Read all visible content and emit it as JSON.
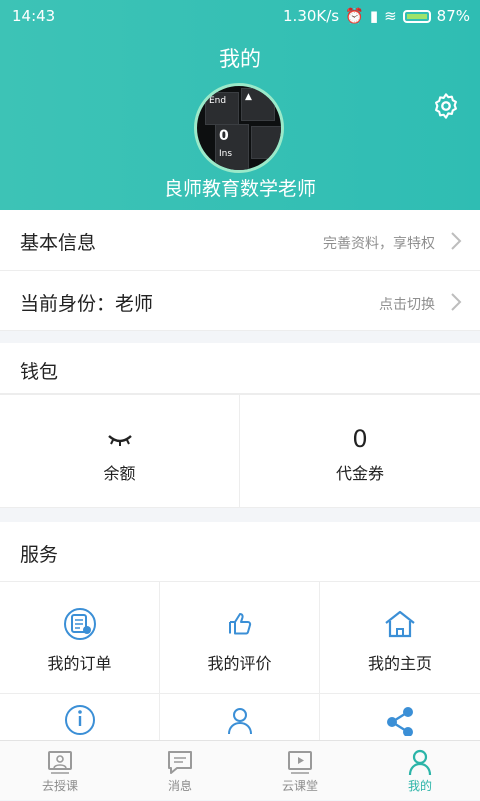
{
  "status_bar": {
    "time": "14:43",
    "network_speed": "1.30K/s",
    "battery": "87%"
  },
  "header": {
    "title": "我的",
    "username": "良师教育数学老师",
    "avatar_keys": [
      "End",
      "0",
      "Ins"
    ]
  },
  "basic_info": {
    "label": "基本信息",
    "hint": "完善资料，享特权"
  },
  "identity": {
    "label": "当前身份：老师",
    "hint": "点击切换"
  },
  "wallet": {
    "title": "钱包",
    "balance": {
      "label": "余额",
      "value_icon": "eye-closed-icon"
    },
    "voucher": {
      "label": "代金券",
      "value": "0"
    }
  },
  "services": {
    "title": "服务",
    "items": [
      {
        "label": "我的订单",
        "icon": "order-icon"
      },
      {
        "label": "我的评价",
        "icon": "thumb-up-icon"
      },
      {
        "label": "我的主页",
        "icon": "home-icon"
      }
    ]
  },
  "tabs": [
    {
      "label": "去授课",
      "icon": "lecture-icon"
    },
    {
      "label": "消息",
      "icon": "message-icon"
    },
    {
      "label": "云课堂",
      "icon": "video-class-icon"
    },
    {
      "label": "我的",
      "icon": "user-icon",
      "active": true
    }
  ],
  "colors": {
    "accent": "#2fbdb3",
    "icon_blue": "#3b8fd6",
    "active_tab": "#2bb4a8"
  }
}
